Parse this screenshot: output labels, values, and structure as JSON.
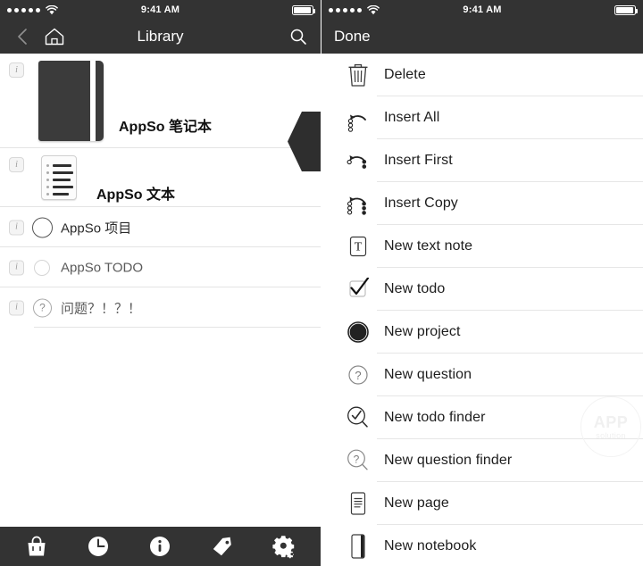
{
  "status_bar": {
    "signal_dots": 5,
    "wifi_icon": "wifi-icon",
    "time": "9:41 AM",
    "battery_icon": "battery-full-icon"
  },
  "left_screen": {
    "nav": {
      "back_icon": "chevron-left-icon",
      "home_icon": "home-icon",
      "title": "Library",
      "search_icon": "search-icon"
    },
    "items": [
      {
        "title": "AppSo 笔记本",
        "icon": "notebook-thumbnail",
        "info_badge": "i",
        "type": "notebook"
      },
      {
        "title": "AppSo 文本",
        "icon": "text-document-thumbnail",
        "info_badge": "i",
        "type": "text"
      },
      {
        "title": "AppSo 项目",
        "icon": "project-circle-icon",
        "info_badge": "i",
        "type": "project"
      },
      {
        "title": "AppSo TODO",
        "icon": "todo-circle-icon",
        "info_badge": "i",
        "type": "todo"
      },
      {
        "title": "问题？！？！",
        "icon": "question-circle-icon",
        "info_badge": "i",
        "type": "question"
      }
    ],
    "drag_handle": "left-arrow-tab",
    "tabbar": [
      {
        "name": "bag-icon",
        "label": "Bag"
      },
      {
        "name": "clock-icon",
        "label": "Recent"
      },
      {
        "name": "info-icon",
        "label": "Info"
      },
      {
        "name": "tag-icon",
        "label": "Tags"
      },
      {
        "name": "gear-icon",
        "label": "Settings"
      }
    ]
  },
  "right_screen": {
    "nav": {
      "done_label": "Done"
    },
    "menu_items": [
      {
        "label": "Delete",
        "icon": "trash-icon"
      },
      {
        "label": "Insert All",
        "icon": "insert-all-icon"
      },
      {
        "label": "Insert First",
        "icon": "insert-first-icon"
      },
      {
        "label": "Insert Copy",
        "icon": "insert-copy-icon"
      },
      {
        "label": "New text note",
        "icon": "text-note-icon"
      },
      {
        "label": "New todo",
        "icon": "checkbox-checked-icon"
      },
      {
        "label": "New project",
        "icon": "pie-chart-icon"
      },
      {
        "label": "New question",
        "icon": "question-circle-icon"
      },
      {
        "label": "New todo finder",
        "icon": "todo-finder-icon"
      },
      {
        "label": "New question finder",
        "icon": "question-finder-icon"
      },
      {
        "label": "New page",
        "icon": "page-icon"
      },
      {
        "label": "New notebook",
        "icon": "notebook-icon"
      }
    ],
    "watermark": {
      "top": "APP",
      "bottom": "solution"
    }
  },
  "colors": {
    "chrome": "#333333",
    "separator": "#e6e6e6",
    "text": "#1d1d1d",
    "accent_dark": "#2e2e2e"
  }
}
